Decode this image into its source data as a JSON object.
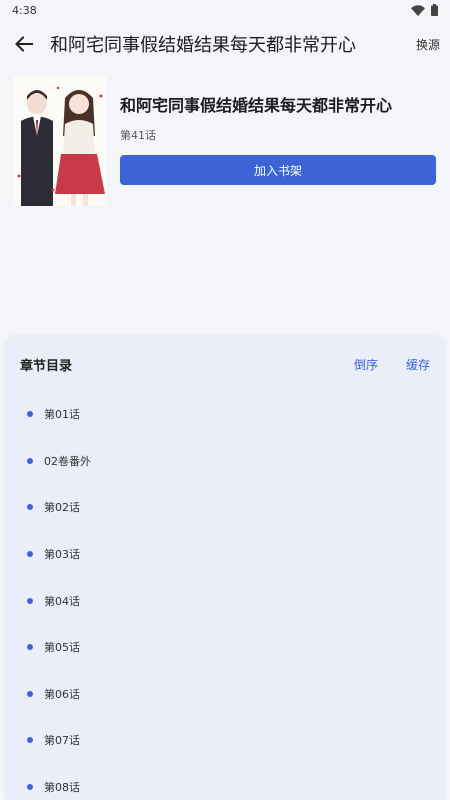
{
  "status": {
    "time": "4:38"
  },
  "appbar": {
    "title": "和阿宅同事假结婚结果每天都非常开心",
    "switch_source": "换源"
  },
  "book": {
    "title": "和阿宅同事假结婚结果每天都非常开心",
    "latest_chapter": "第41话",
    "add_shelf": "加入书架"
  },
  "chapters": {
    "header": "章节目录",
    "reverse": "倒序",
    "cache": "缓存",
    "items": [
      {
        "label": "第01话"
      },
      {
        "label": "02卷番外"
      },
      {
        "label": "第02话"
      },
      {
        "label": "第03话"
      },
      {
        "label": "第04话"
      },
      {
        "label": "第05话"
      },
      {
        "label": "第06话"
      },
      {
        "label": "第07话"
      },
      {
        "label": "第08话"
      }
    ]
  },
  "colors": {
    "accent": "#3c64d6",
    "background": "#f4f5f9",
    "panel": "#e9eef9"
  },
  "icons": {
    "back": "arrow-left-icon",
    "wifi": "wifi-icon",
    "battery": "battery-icon"
  }
}
